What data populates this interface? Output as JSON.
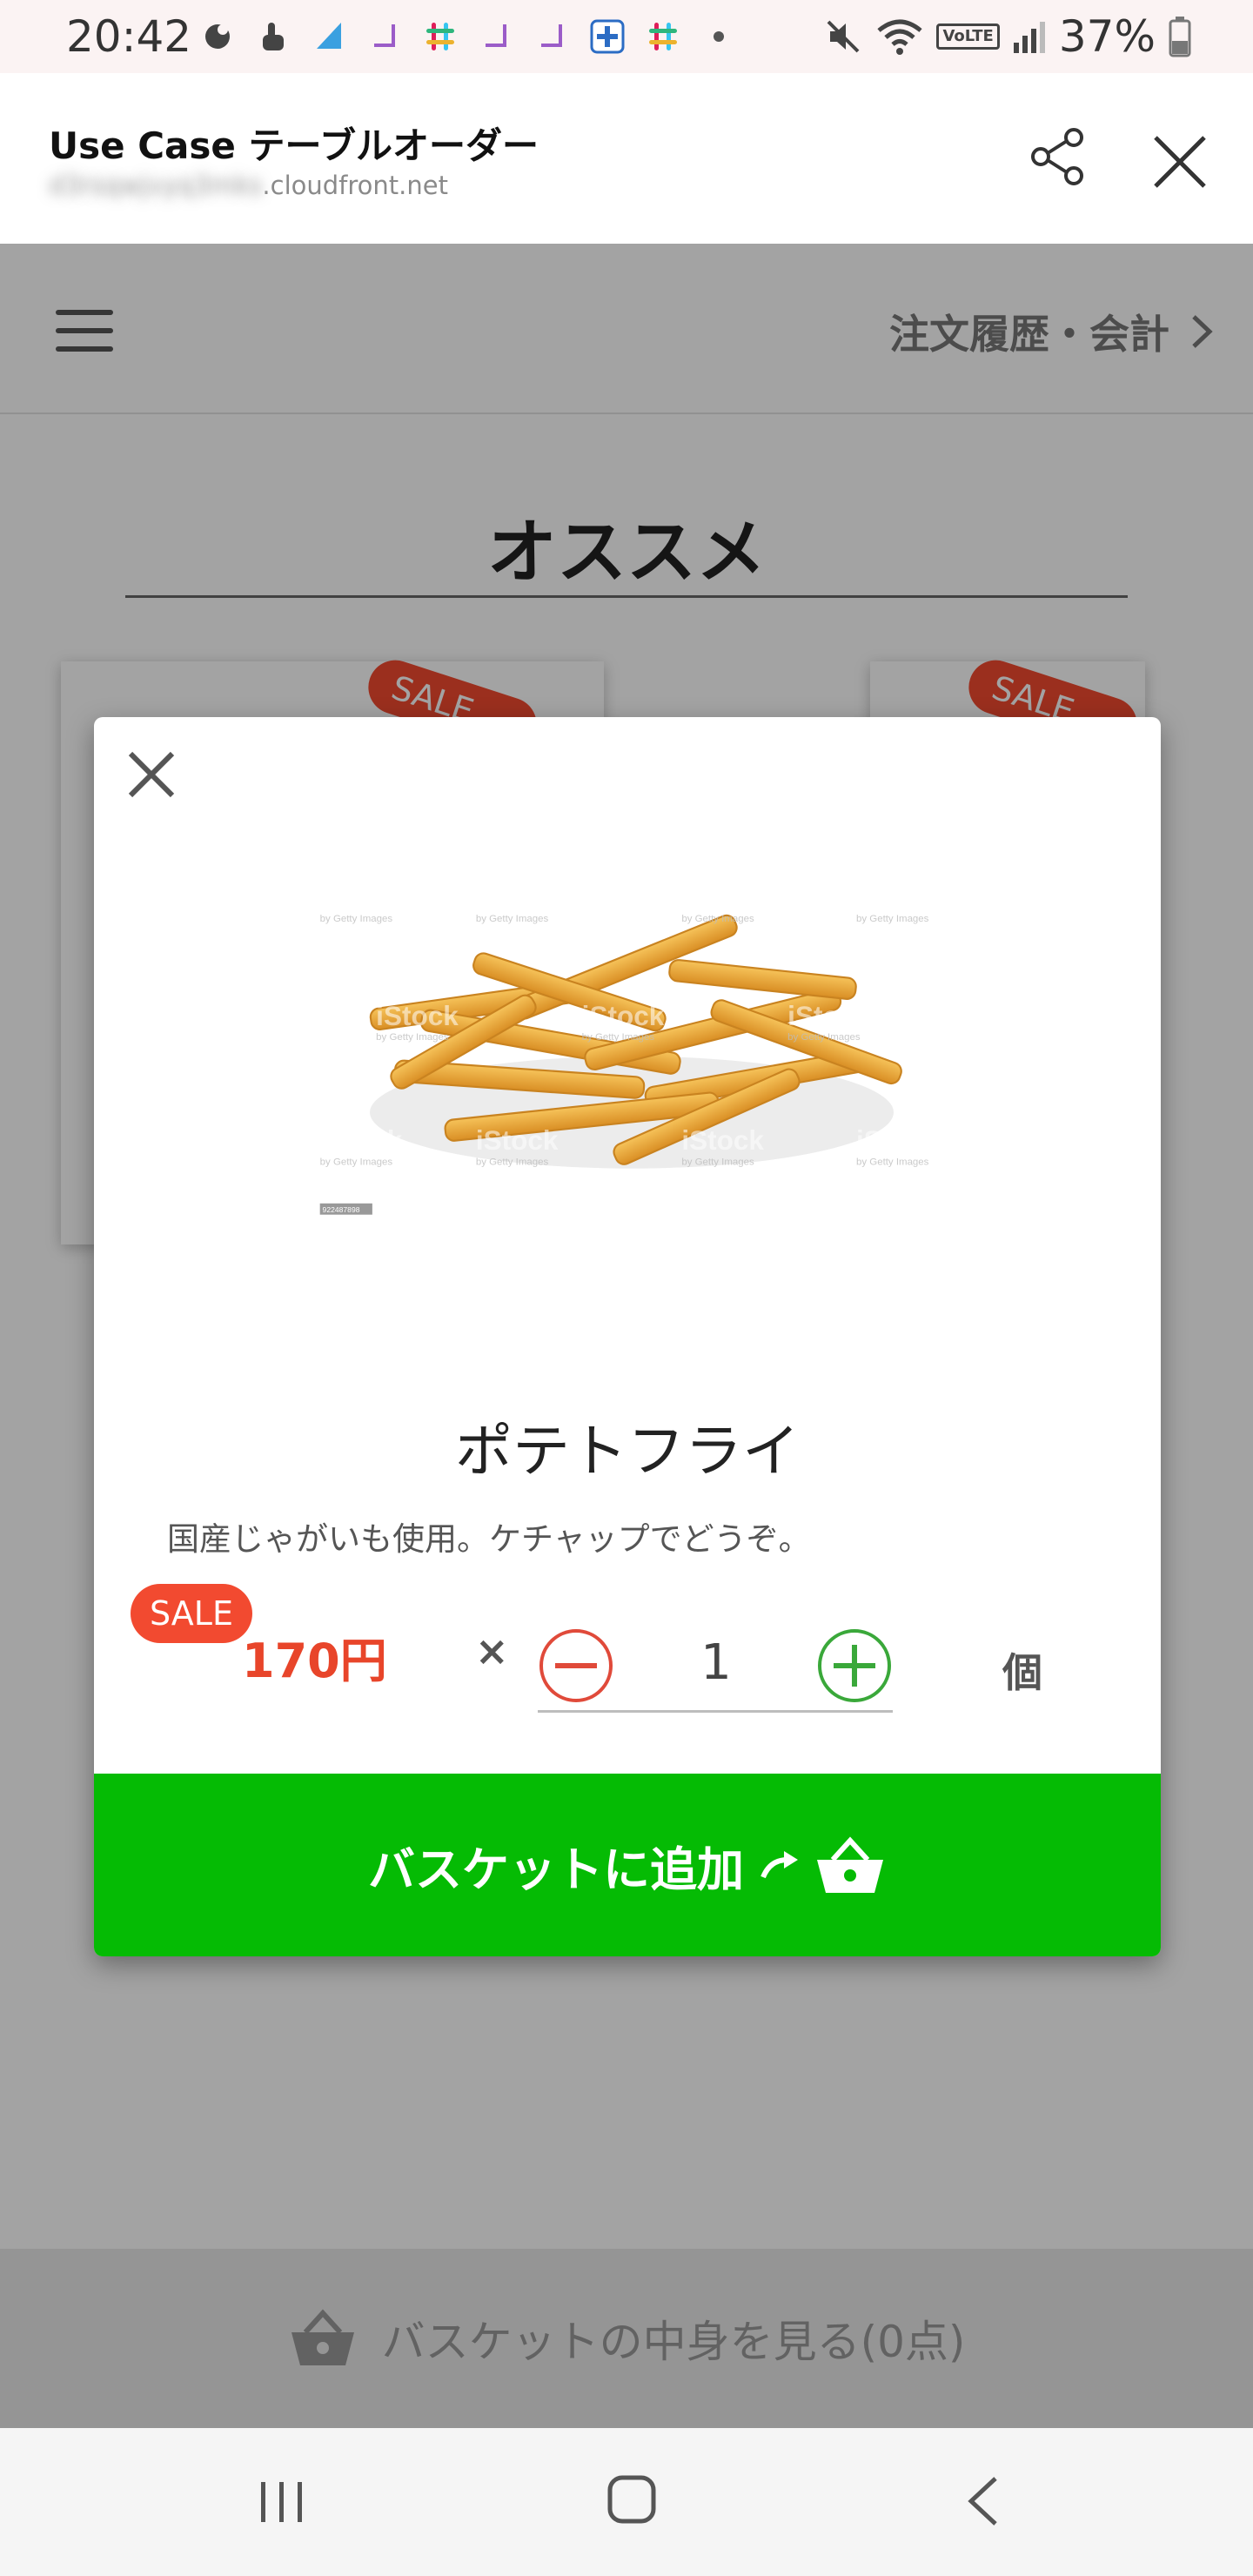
{
  "status_bar": {
    "time": "20:42",
    "icons_left": [
      "app-icon",
      "touch-icon",
      "triangle-app-icon",
      "corner-app-icon",
      "slack-icon",
      "corner-app-icon",
      "corner-app-icon",
      "plus-app-icon",
      "slack-icon",
      "dot-icon"
    ],
    "icons_right": [
      "mute-icon",
      "wifi-icon",
      "volte-icon",
      "signal-icon",
      "battery-icon"
    ],
    "volte_label": "VoLTE",
    "battery": "37%"
  },
  "browser": {
    "title": "Use Case テーブルオーダー",
    "url_hidden": "d3rsqwjvyq3mks",
    "url_domain": ".cloudfront.net"
  },
  "app_header": {
    "order_history_label": "注文履歴・会計"
  },
  "section": {
    "title": "オススメ"
  },
  "cards": [
    {
      "badge": "SALE"
    },
    {
      "badge": "SALE"
    }
  ],
  "modal": {
    "product_name": "ポテトフライ",
    "description": "国産じゃがいも使用。ケチャップでどうぞ。",
    "sale_badge": "SALE",
    "price": "170円",
    "times": "×",
    "quantity": "1",
    "unit": "個",
    "add_button_label": "バスケットに追加",
    "watermark_text": "iStock",
    "watermark_sub": "by Getty Images",
    "image_id": "922487898"
  },
  "basket_bar": {
    "label": "バスケットの中身を見る(0点)"
  },
  "colors": {
    "accent_green": "#05bb04",
    "sale_red": "#f24a30",
    "price_red": "#e8452a",
    "minus_red": "#e04a3a",
    "plus_green": "#3aa83a"
  }
}
